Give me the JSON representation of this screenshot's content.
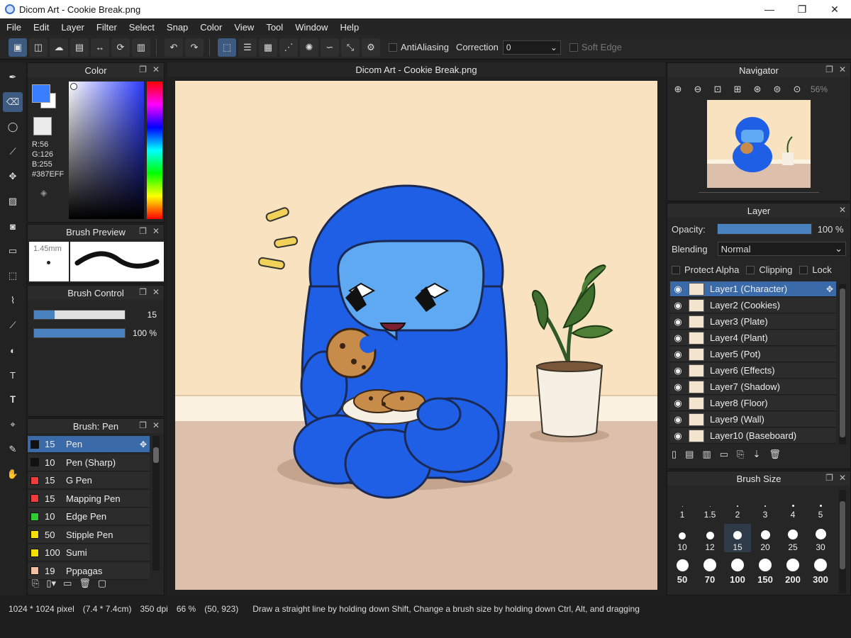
{
  "window": {
    "title": "Dicom Art - Cookie Break.png",
    "minimize": "—",
    "maximize": "❐",
    "close": "✕"
  },
  "menu": [
    "File",
    "Edit",
    "Layer",
    "Filter",
    "Select",
    "Snap",
    "Color",
    "View",
    "Tool",
    "Window",
    "Help"
  ],
  "toolbar": {
    "antialiasing_label": "AntiAliasing",
    "correction_label": "Correction",
    "correction_value": "0",
    "soft_edge_label": "Soft Edge"
  },
  "color_panel": {
    "title": "Color",
    "r": "R:56",
    "g": "G:126",
    "b": "B:255",
    "hex": "#387EFF",
    "primary_color": "#387eff"
  },
  "brush_preview": {
    "title": "Brush Preview",
    "size_label": "1.45mm"
  },
  "brush_control": {
    "title": "Brush Control",
    "size_value": "15",
    "size_level": 0.23,
    "opacity_value": "100 %",
    "opacity_level": 1.0
  },
  "brush_list": {
    "title": "Brush: Pen",
    "items": [
      {
        "size": "15",
        "name": "Pen",
        "color": "#111111",
        "selected": true
      },
      {
        "size": "10",
        "name": "Pen (Sharp)",
        "color": "#111111"
      },
      {
        "size": "15",
        "name": "G Pen",
        "color": "#ee3b3b"
      },
      {
        "size": "15",
        "name": "Mapping Pen",
        "color": "#ee3b3b"
      },
      {
        "size": "10",
        "name": "Edge Pen",
        "color": "#2ecc2e"
      },
      {
        "size": "50",
        "name": "Stipple Pen",
        "color": "#f5e000"
      },
      {
        "size": "100",
        "name": "Sumi",
        "color": "#f5e000"
      },
      {
        "size": "19",
        "name": "Pppagas",
        "color": "#f2c0a0"
      }
    ]
  },
  "canvas": {
    "title": "Dicom Art - Cookie Break.png"
  },
  "navigator": {
    "title": "Navigator",
    "zoom": "56%"
  },
  "layers": {
    "title": "Layer",
    "opacity_label": "Opacity:",
    "opacity_value": "100 %",
    "blending_label": "Blending",
    "blending_value": "Normal",
    "protect_alpha": "Protect Alpha",
    "clipping": "Clipping",
    "lock": "Lock",
    "items": [
      {
        "name": "Layer1 (Character)",
        "selected": true
      },
      {
        "name": "Layer2 (Cookies)"
      },
      {
        "name": "Layer3 (Plate)"
      },
      {
        "name": "Layer4 (Plant)"
      },
      {
        "name": "Layer5 (Pot)"
      },
      {
        "name": "Layer6 (Effects)"
      },
      {
        "name": "Layer7 (Shadow)"
      },
      {
        "name": "Layer8 (Floor)"
      },
      {
        "name": "Layer9 (Wall)"
      },
      {
        "name": "Layer10 (Baseboard)"
      }
    ]
  },
  "brush_size": {
    "title": "Brush Size",
    "rows": [
      [
        "1",
        "1.5",
        "2",
        "3",
        "4",
        "5"
      ],
      [
        "10",
        "12",
        "15",
        "20",
        "25",
        "30"
      ],
      [
        "50",
        "70",
        "100",
        "150",
        "200",
        "300"
      ]
    ],
    "selected": "15"
  },
  "status": {
    "dimensions": "1024 * 1024 pixel",
    "physical": "(7.4 * 7.4cm)",
    "dpi": "350 dpi",
    "zoom": "66 %",
    "coords": "(50, 923)",
    "hint": "Draw a straight line by holding down Shift, Change a brush size by holding down Ctrl, Alt, and dragging"
  }
}
